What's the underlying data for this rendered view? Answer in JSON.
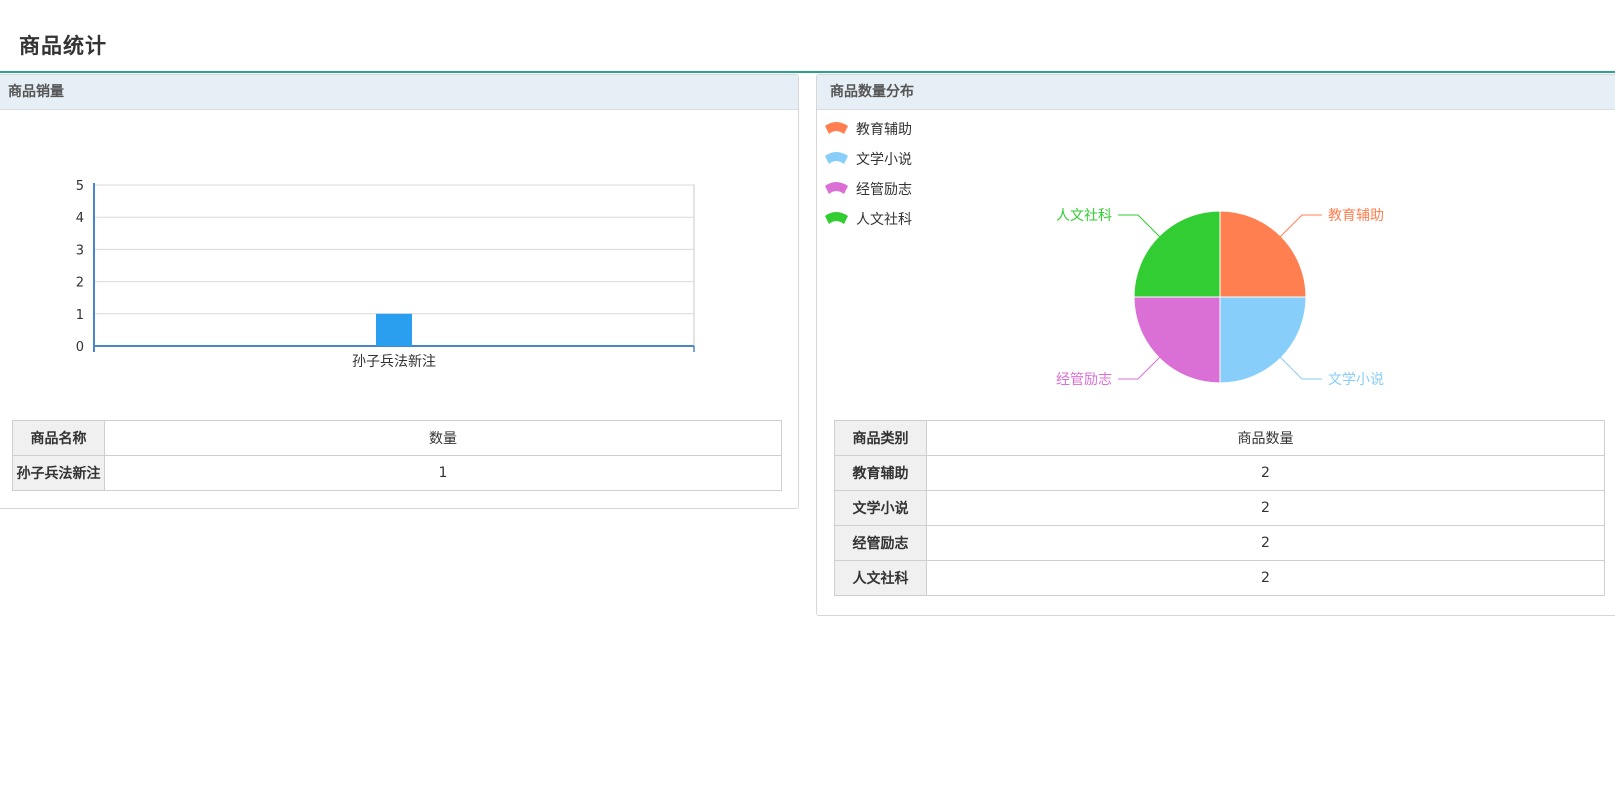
{
  "page": {
    "title": "商品统计"
  },
  "sales_panel": {
    "title": "商品销量",
    "table": {
      "headers": [
        "商品名称",
        "数量"
      ],
      "rows": [
        {
          "name": "孙子兵法新注",
          "value": "1"
        }
      ]
    }
  },
  "category_panel": {
    "title": "商品数量分布",
    "legend": [
      "教育辅助",
      "文学小说",
      "经管励志",
      "人文社科"
    ],
    "table": {
      "headers": [
        "商品类别",
        "商品数量"
      ],
      "rows": [
        {
          "name": "教育辅助",
          "value": "2"
        },
        {
          "name": "文学小说",
          "value": "2"
        },
        {
          "name": "经管励志",
          "value": "2"
        },
        {
          "name": "人文社科",
          "value": "2"
        }
      ]
    }
  },
  "chart_data": [
    {
      "type": "bar",
      "categories": [
        "孙子兵法新注"
      ],
      "values": [
        1
      ],
      "ylim": [
        0,
        5
      ],
      "yticks": [
        0,
        1,
        2,
        3,
        4,
        5
      ],
      "grid": true,
      "colors": {
        "bar": "#2a9ff0",
        "axis": "#4a86c5",
        "grid": "#d9d9d9"
      }
    },
    {
      "type": "pie",
      "slices": [
        {
          "label": "教育辅助",
          "value": 2,
          "color": "#ff7f50"
        },
        {
          "label": "文学小说",
          "value": 2,
          "color": "#87cefa"
        },
        {
          "label": "经管励志",
          "value": 2,
          "color": "#da70d6"
        },
        {
          "label": "人文社科",
          "value": 2,
          "color": "#32cd32"
        }
      ],
      "legend_position": "top-left"
    }
  ]
}
